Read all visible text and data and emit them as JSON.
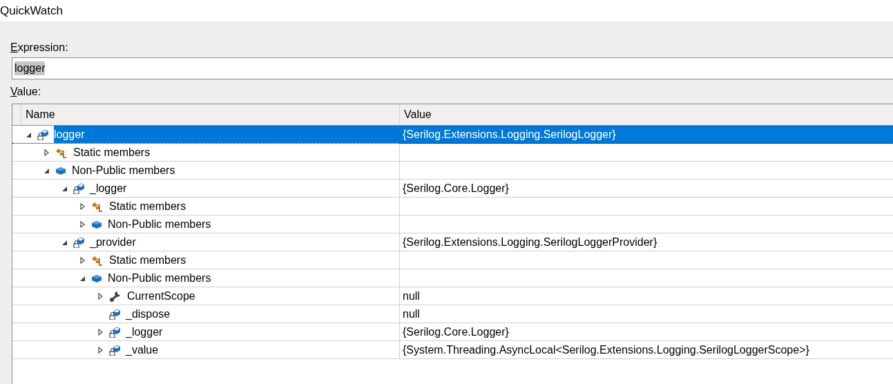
{
  "window": {
    "title": "QuickWatch"
  },
  "expression": {
    "label": "Expression:",
    "value": "logger"
  },
  "value_label": "Value:",
  "grid": {
    "columns": [
      "Name",
      "Value"
    ],
    "rows": [
      {
        "name": "logger",
        "value": "{Serilog.Extensions.Logging.SerilogLogger}",
        "kind": "field",
        "expanded": true,
        "selected": true,
        "children": [
          {
            "name": "Static members",
            "kind": "static",
            "expanded": false,
            "selected": false
          },
          {
            "name": "Non-Public members",
            "kind": "nonpublic",
            "expanded": true,
            "selected": false,
            "children": [
              {
                "name": "_logger",
                "value": "{Serilog.Core.Logger}",
                "kind": "field",
                "expanded": true,
                "selected": false,
                "children": [
                  {
                    "name": "Static members",
                    "kind": "static",
                    "expanded": false,
                    "selected": false
                  },
                  {
                    "name": "Non-Public members",
                    "kind": "nonpublic",
                    "expanded": false,
                    "selected": false
                  }
                ]
              },
              {
                "name": "_provider",
                "value": "{Serilog.Extensions.Logging.SerilogLoggerProvider}",
                "kind": "field",
                "expanded": true,
                "selected": false,
                "children": [
                  {
                    "name": "Static members",
                    "kind": "static",
                    "expanded": false,
                    "selected": false
                  },
                  {
                    "name": "Non-Public members",
                    "kind": "nonpublic",
                    "expanded": true,
                    "selected": false,
                    "children": [
                      {
                        "name": "CurrentScope",
                        "value": "null",
                        "kind": "property",
                        "expanded": false,
                        "selected": false
                      },
                      {
                        "name": "_dispose",
                        "value": "null",
                        "kind": "field",
                        "selected": false
                      },
                      {
                        "name": "_logger",
                        "value": "{Serilog.Core.Logger}",
                        "kind": "field",
                        "expanded": false,
                        "selected": false
                      },
                      {
                        "name": "_value",
                        "value": "{System.Threading.AsyncLocal<Serilog.Extensions.Logging.SerilogLoggerScope>}",
                        "kind": "field",
                        "expanded": false,
                        "selected": false
                      }
                    ]
                  }
                ]
              }
            ]
          }
        ]
      }
    ]
  }
}
